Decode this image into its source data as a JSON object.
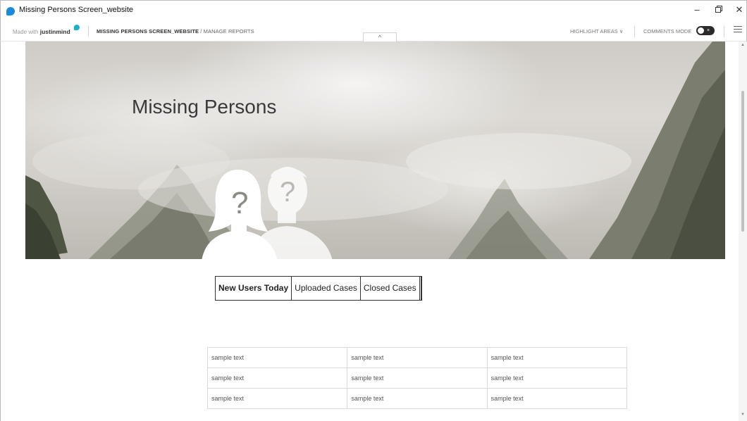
{
  "window": {
    "title": "Missing Persons Screen_website",
    "minimize": "–",
    "close": "✕"
  },
  "toolbar": {
    "made_with": "Made with",
    "brand": "justinmind",
    "breadcrumb_root": "MISSING PERSONS SCREEN_WEBSITE",
    "breadcrumb_separator": " / ",
    "breadcrumb_page": "MANAGE REPORTS",
    "collapse_glyph": "^",
    "highlight_areas": "HIGHLIGHT AREAS",
    "highlight_chevron": "∨",
    "comments_mode": "COMMENTS MODE",
    "toggle_glyph": "×"
  },
  "hero": {
    "title": "Missing Persons",
    "question_mark": "?"
  },
  "tabs": [
    {
      "label": "New Users Today",
      "active": true
    },
    {
      "label": "Uploaded Cases",
      "active": false
    },
    {
      "label": "Closed Cases",
      "active": false
    }
  ],
  "table": {
    "rows": [
      [
        "sample text",
        "sample text",
        "sample text"
      ],
      [
        "sample text",
        "sample text",
        "sample text"
      ],
      [
        "sample text",
        "sample text",
        "sample text"
      ]
    ]
  },
  "colors": {
    "app_icon": "#1b8ad8",
    "brand_dot": "#19b3c9",
    "toggle_bg": "#2b2b2b"
  },
  "icons": {
    "app": "app-icon",
    "collapse": "chevron-up-icon",
    "highlight": "chevron-down-icon",
    "menu": "hamburger-menu-icon",
    "persons": "missing-persons-silhouette-icon"
  }
}
